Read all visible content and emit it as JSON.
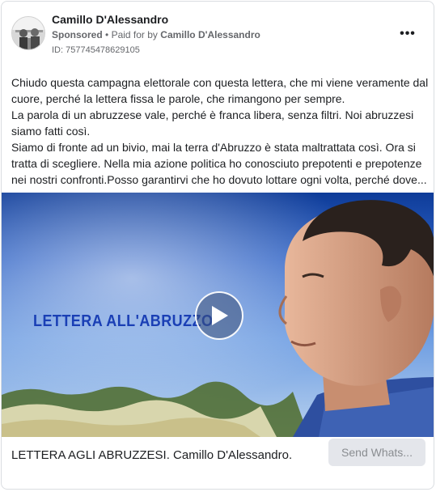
{
  "header": {
    "page_name": "Camillo D'Alessandro",
    "sponsored_label": "Sponsored",
    "separator": "•",
    "paid_for_label": "Paid for by",
    "paid_for_name": "Camillo D'Alessandro",
    "ad_id": "ID: 757745478629105",
    "more_icon": "more-horizontal-icon",
    "more_label": "•••"
  },
  "body": {
    "paragraphs": [
      "Chiudo questa campagna elettorale con questa lettera, che mi viene veramente dal cuore, perché la lettera fissa le parole, che rimangono per sempre.",
      "La parola di un abruzzese vale, perché è franca libera, senza filtri. Noi abruzzesi siamo fatti così.",
      "Siamo di fronte ad un bivio, mai la terra d'Abruzzo è stata maltrattata così. Ora si tratta di scegliere. Nella mia azione politica ho conosciuto prepotenti e prepotenze nei nostri confronti.Posso garantirvi che ho dovuto lottare ogni volta, perché dove..."
    ]
  },
  "media": {
    "overlay_title": "LETTERA ALL'ABRUZZO",
    "play_icon": "play-icon"
  },
  "footer": {
    "caption": "LETTERA AGLI ABRUZZESI. Camillo D'Alessandro.",
    "cta_label": "Send Whats..."
  }
}
